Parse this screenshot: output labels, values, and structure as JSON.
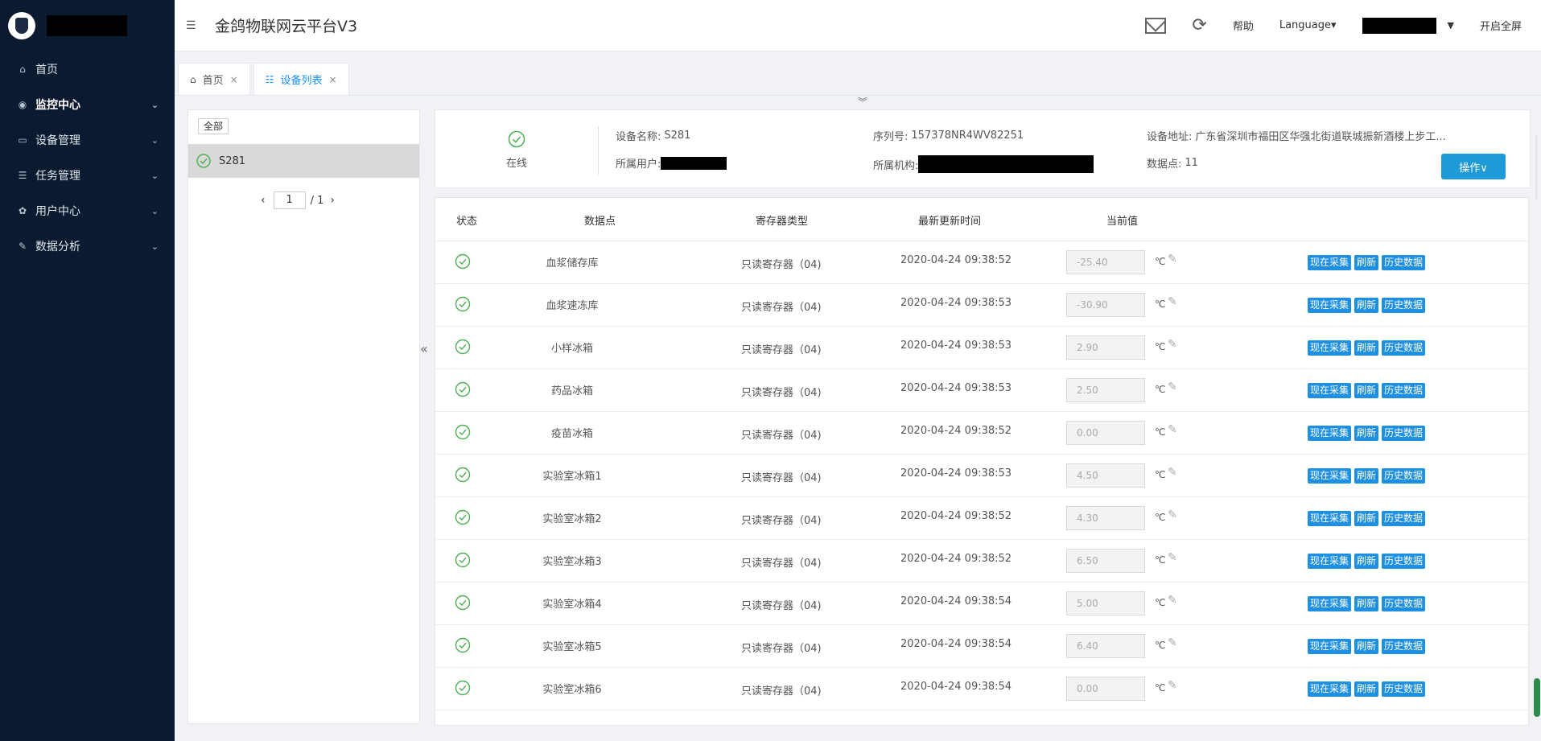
{
  "sidebar": {
    "items": [
      {
        "label": "首页",
        "icon": "home-icon",
        "glyph": "⌂",
        "has_chevron": false
      },
      {
        "label": "监控中心",
        "icon": "location-icon",
        "glyph": "◉",
        "has_chevron": true,
        "active": true
      },
      {
        "label": "设备管理",
        "icon": "monitor-icon",
        "glyph": "▭",
        "has_chevron": true
      },
      {
        "label": "任务管理",
        "icon": "task-list-icon",
        "glyph": "☰",
        "has_chevron": true
      },
      {
        "label": "用户中心",
        "icon": "gear-icon",
        "glyph": "✿",
        "has_chevron": true
      },
      {
        "label": "数据分析",
        "icon": "edit-chart-icon",
        "glyph": "✎",
        "has_chevron": true
      }
    ]
  },
  "header": {
    "title": "金鸽物联网云平台V3",
    "help": "帮助",
    "language": "Language▾",
    "fullscreen": "开启全屏"
  },
  "tabs": [
    {
      "label": "首页",
      "icon": "home-icon",
      "glyph": "⌂",
      "active": false
    },
    {
      "label": "设备列表",
      "icon": "list-icon",
      "glyph": "☷",
      "active": true
    }
  ],
  "device_list": {
    "all_label": "全部",
    "devices": [
      {
        "name": "S281"
      }
    ],
    "page": "1",
    "total": "/ 1"
  },
  "info": {
    "status": "在线",
    "device_name_label": "设备名称:",
    "device_name": "S281",
    "serial_label": "序列号:",
    "serial": "157378NR4WV82251",
    "address_label": "设备地址:",
    "address": "广东省深圳市福田区华强北街道联城振新酒楼上步工...",
    "user_label": "所属用户:",
    "org_label": "所属机构:",
    "points_label": "数据点:",
    "points": "11",
    "op_button": "操作∨"
  },
  "table": {
    "headers": {
      "status": "状态",
      "point": "数据点",
      "reg": "寄存器类型",
      "time": "最新更新时间",
      "value": "当前值"
    },
    "buttons": {
      "collect": "现在采集",
      "refresh": "刷新",
      "history": "历史数据"
    },
    "rows": [
      {
        "name": "血浆储存库",
        "reg": "只读寄存器（04)",
        "time": "2020-04-24 09:38:52",
        "value": "-25.40",
        "unit": "℃"
      },
      {
        "name": "血浆速冻库",
        "reg": "只读寄存器（04)",
        "time": "2020-04-24 09:38:53",
        "value": "-30.90",
        "unit": "℃"
      },
      {
        "name": "小样冰箱",
        "reg": "只读寄存器（04)",
        "time": "2020-04-24 09:38:53",
        "value": "2.90",
        "unit": "℃"
      },
      {
        "name": "药品冰箱",
        "reg": "只读寄存器（04)",
        "time": "2020-04-24 09:38:53",
        "value": "2.50",
        "unit": "℃"
      },
      {
        "name": "疫苗冰箱",
        "reg": "只读寄存器（04)",
        "time": "2020-04-24 09:38:52",
        "value": "0.00",
        "unit": "℃"
      },
      {
        "name": "实验室冰箱1",
        "reg": "只读寄存器（04)",
        "time": "2020-04-24 09:38:53",
        "value": "4.50",
        "unit": "℃"
      },
      {
        "name": "实验室冰箱2",
        "reg": "只读寄存器（04)",
        "time": "2020-04-24 09:38:52",
        "value": "4.30",
        "unit": "℃"
      },
      {
        "name": "实验室冰箱3",
        "reg": "只读寄存器（04)",
        "time": "2020-04-24 09:38:52",
        "value": "6.50",
        "unit": "℃"
      },
      {
        "name": "实验室冰箱4",
        "reg": "只读寄存器（04)",
        "time": "2020-04-24 09:38:54",
        "value": "5.00",
        "unit": "℃"
      },
      {
        "name": "实验室冰箱5",
        "reg": "只读寄存器（04)",
        "time": "2020-04-24 09:38:54",
        "value": "6.40",
        "unit": "℃"
      },
      {
        "name": "实验室冰箱6",
        "reg": "只读寄存器（04)",
        "time": "2020-04-24 09:38:54",
        "value": "0.00",
        "unit": "℃"
      }
    ]
  },
  "colors": {
    "sidebar_bg": "#0b1a2f",
    "accent": "#1890ff",
    "ok_green": "#4caf50",
    "op_button": "#1e9bd7"
  }
}
